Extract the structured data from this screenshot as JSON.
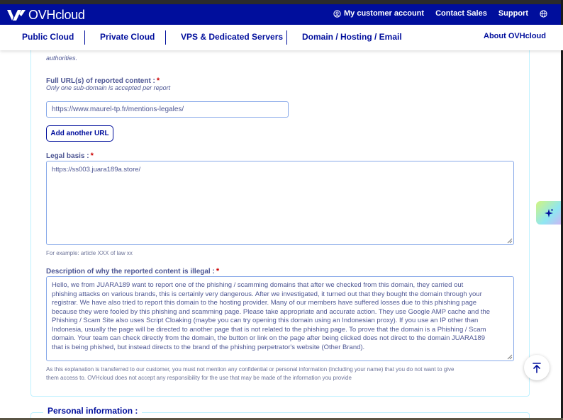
{
  "header": {
    "logo_text": "OVHcloud",
    "links": {
      "account": "My customer account",
      "contact": "Contact Sales",
      "support": "Support"
    }
  },
  "nav": {
    "items": [
      "Public Cloud",
      "Private Cloud",
      "VPS & Dedicated Servers",
      "Domain / Hosting / Email"
    ],
    "about": "About OVHcloud"
  },
  "form": {
    "authorities_tail": "authorities.",
    "url": {
      "label": "Full URL(s) of reported content :",
      "required": "*",
      "hint": "Only one sub-domain is accepted per report",
      "value": "https://www.maurel-tp.fr/mentions-legales/",
      "add_button": "Add another URL"
    },
    "legal_basis": {
      "label": "Legal basis :",
      "required": "*",
      "value": "https://ss003.juara189a.store/",
      "example": "For example: article XXX of law xx"
    },
    "description": {
      "label": "Description of why the reported content is illegal :",
      "required": "*",
      "lines": [
        "Hello, we from JUARA189 want to report one of the phishing / scamming domains that after we checked from this domain, they carried out",
        "phishing attacks on various brands, this is certainly very dangerous. After we investigated, it turned out that they bought the domain through your",
        "registrar. We have also tried to report this domain to the hosting provider. Many of our members have suffered losses due to this phishing page",
        "because they were fooled by this phishing and scamming page. Please take appropriate and accurate action. They use Google AMP cache and the",
        "Phishing / Scam Site also uses Script Cloaking (maybe you can try opening this domain using an Indonesian proxy). If you use an IP other than",
        "Indonesia, usually the page will be directed to another page that is not related to the phishing page. To prove that the domain is a Phishing / Scam",
        "domain. Your team can check directly from the domain, the button or link on the page after being clicked does not direct to the domain JUARA189",
        "that is being phished, but instead directs to the brand of the phishing perpetrator's website (Other Brand)."
      ],
      "disclaimer_1": "As this explanation is transferred to our customer, you must not mention any confidential or personal information (including your name) that you do not want to give",
      "disclaimer_2": "them access to. OVHcloud does not accept any responsibility for the use that may be made of the information you provide"
    },
    "personal_section": "Personal information :"
  }
}
